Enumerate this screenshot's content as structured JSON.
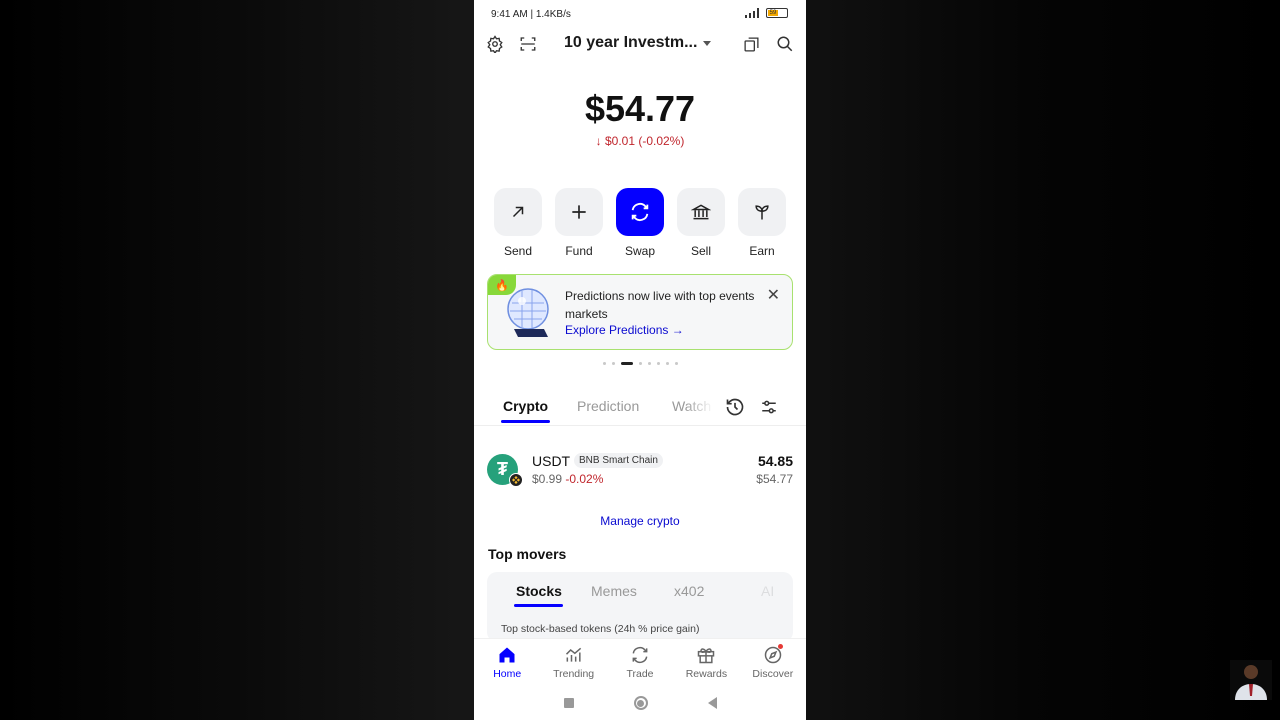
{
  "status_bar": {
    "time_speed": "9:41 AM | 1.4KB/s",
    "battery": "59"
  },
  "header": {
    "wallet_name": "10 year Investm...",
    "icons": [
      "settings-icon",
      "scan-icon",
      "copy-icon",
      "search-icon"
    ]
  },
  "balance": {
    "amount": "$54.77",
    "change": "$0.01 (-0.02%)",
    "change_color": "#c0262d"
  },
  "actions": [
    {
      "label": "Send",
      "icon": "arrow-up-right-icon"
    },
    {
      "label": "Fund",
      "icon": "plus-icon"
    },
    {
      "label": "Swap",
      "icon": "swap-icon"
    },
    {
      "label": "Sell",
      "icon": "bank-icon"
    },
    {
      "label": "Earn",
      "icon": "sprout-icon"
    }
  ],
  "banner": {
    "text": "Predictions now live with top events markets",
    "link": "Explore Predictions →",
    "border_color": "#a8e16f"
  },
  "carousel": {
    "count": 9,
    "active_index": 2
  },
  "asset_tabs": [
    "Crypto",
    "Prediction",
    "Watch"
  ],
  "assets": [
    {
      "symbol": "USDT",
      "chain": "BNB Smart Chain",
      "price": "$0.99",
      "change": "-0.02%",
      "amount": "54.85",
      "value": "$54.77"
    }
  ],
  "manage_label": "Manage crypto",
  "top_movers": {
    "title": "Top movers",
    "tabs": [
      "Stocks",
      "Memes",
      "x402",
      "AI"
    ],
    "description": "Top stock-based tokens (24h % price gain)"
  },
  "bottom_nav": [
    {
      "label": "Home",
      "icon": "home-icon"
    },
    {
      "label": "Trending",
      "icon": "trending-icon"
    },
    {
      "label": "Trade",
      "icon": "trade-icon"
    },
    {
      "label": "Rewards",
      "icon": "gift-icon"
    },
    {
      "label": "Discover",
      "icon": "compass-icon"
    }
  ],
  "accent_color": "#0500ff"
}
